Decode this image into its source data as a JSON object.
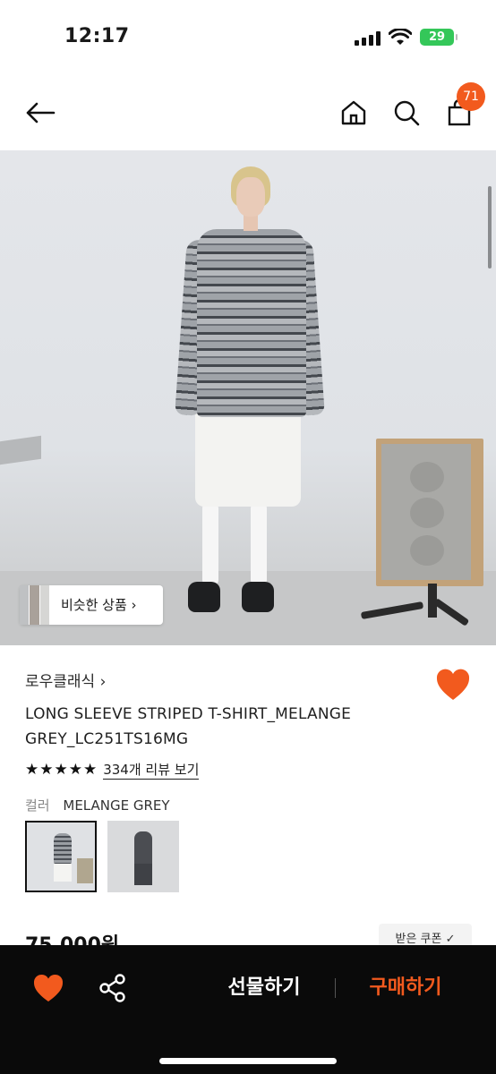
{
  "status_bar": {
    "time": "12:17",
    "battery": "29"
  },
  "header": {
    "cart_count": "71"
  },
  "hero": {
    "similar_products_label": "비슷한 상품 ›"
  },
  "product": {
    "brand": "로우클래식 ›",
    "title": "LONG SLEEVE STRIPED T-SHIRT_MELANGE GREY_LC251TS16MG",
    "stars": "★★★★★",
    "review_link": "334개 리뷰 보기",
    "color_label": "컬러",
    "color_value": "MELANGE GREY",
    "price": "75,000원",
    "coupon_button": "받은 쿠폰 ✓"
  },
  "bottom_bar": {
    "gift_label": "선물하기",
    "buy_label": "구매하기"
  },
  "colors": {
    "accent": "#f25a1e",
    "bottom_bar_bg": "#0a0a0a"
  }
}
